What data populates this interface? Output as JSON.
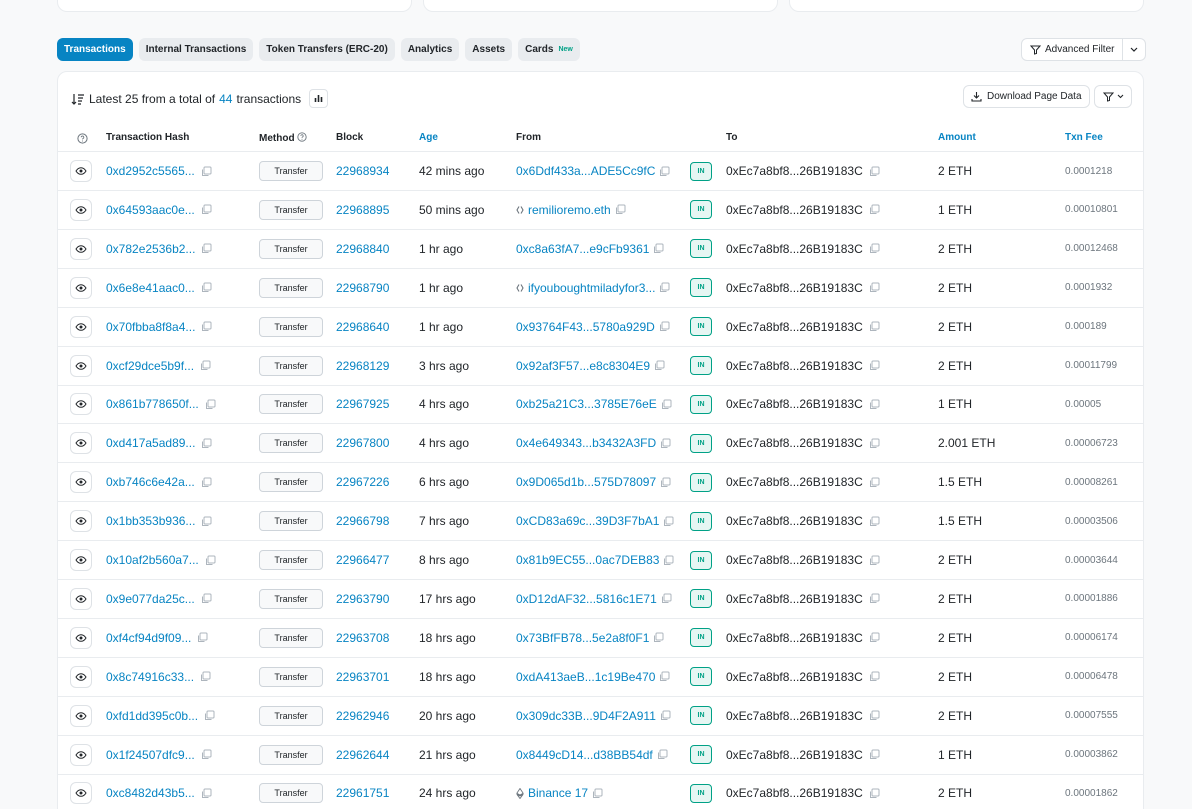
{
  "tabs": [
    {
      "label": "Transactions",
      "active": true
    },
    {
      "label": "Internal Transactions"
    },
    {
      "label": "Token Transfers (ERC-20)"
    },
    {
      "label": "Analytics"
    },
    {
      "label": "Assets"
    },
    {
      "label": "Cards",
      "badge": "New"
    }
  ],
  "advanced_filter": {
    "label": "Advanced Filter"
  },
  "summary": {
    "prefix": "Latest 25 from a total of",
    "count": "44",
    "suffix": "transactions"
  },
  "download": {
    "label": "Download Page Data"
  },
  "columns": {
    "hash": "Transaction Hash",
    "method": "Method",
    "block": "Block",
    "age": "Age",
    "from": "From",
    "to": "To",
    "amount": "Amount",
    "fee": "Txn Fee"
  },
  "rows": [
    {
      "hash": "0xd2952c5565...",
      "method": "Transfer",
      "block": "22968934",
      "age": "42 mins ago",
      "from": "0x6Ddf433a...ADE5Cc9fC",
      "from_type": "address",
      "dir": "IN",
      "to": "0xEc7a8bf8...26B19183C",
      "amount": "2 ETH",
      "fee": "0.0001218"
    },
    {
      "hash": "0x64593aac0e...",
      "method": "Transfer",
      "block": "22968895",
      "age": "50 mins ago",
      "from": "remilioremo.eth",
      "from_type": "ens",
      "dir": "IN",
      "to": "0xEc7a8bf8...26B19183C",
      "amount": "1 ETH",
      "fee": "0.00010801"
    },
    {
      "hash": "0x782e2536b2...",
      "method": "Transfer",
      "block": "22968840",
      "age": "1 hr ago",
      "from": "0xc8a63fA7...e9cFb9361",
      "from_type": "address",
      "dir": "IN",
      "to": "0xEc7a8bf8...26B19183C",
      "amount": "2 ETH",
      "fee": "0.00012468"
    },
    {
      "hash": "0x6e8e41aac0...",
      "method": "Transfer",
      "block": "22968790",
      "age": "1 hr ago",
      "from": "ifyouboughtmiladyfor3...",
      "from_type": "ens",
      "dir": "IN",
      "to": "0xEc7a8bf8...26B19183C",
      "amount": "2 ETH",
      "fee": "0.0001932"
    },
    {
      "hash": "0x70fbba8f8a4...",
      "method": "Transfer",
      "block": "22968640",
      "age": "1 hr ago",
      "from": "0x93764F43...5780a929D",
      "from_type": "address",
      "dir": "IN",
      "to": "0xEc7a8bf8...26B19183C",
      "amount": "2 ETH",
      "fee": "0.000189"
    },
    {
      "hash": "0xcf29dce5b9f...",
      "method": "Transfer",
      "block": "22968129",
      "age": "3 hrs ago",
      "from": "0x92af3F57...e8c8304E9",
      "from_type": "address",
      "dir": "IN",
      "to": "0xEc7a8bf8...26B19183C",
      "amount": "2 ETH",
      "fee": "0.00011799"
    },
    {
      "hash": "0x861b778650f...",
      "method": "Transfer",
      "block": "22967925",
      "age": "4 hrs ago",
      "from": "0xb25a21C3...3785E76eE",
      "from_type": "address",
      "dir": "IN",
      "to": "0xEc7a8bf8...26B19183C",
      "amount": "1 ETH",
      "fee": "0.00005"
    },
    {
      "hash": "0xd417a5ad89...",
      "method": "Transfer",
      "block": "22967800",
      "age": "4 hrs ago",
      "from": "0x4e649343...b3432A3FD",
      "from_type": "address",
      "dir": "IN",
      "to": "0xEc7a8bf8...26B19183C",
      "amount": "2.001 ETH",
      "fee": "0.00006723"
    },
    {
      "hash": "0xb746c6e42a...",
      "method": "Transfer",
      "block": "22967226",
      "age": "6 hrs ago",
      "from": "0x9D065d1b...575D78097",
      "from_type": "address",
      "dir": "IN",
      "to": "0xEc7a8bf8...26B19183C",
      "amount": "1.5 ETH",
      "fee": "0.00008261"
    },
    {
      "hash": "0x1bb353b936...",
      "method": "Transfer",
      "block": "22966798",
      "age": "7 hrs ago",
      "from": "0xCD83a69c...39D3F7bA1",
      "from_type": "address",
      "dir": "IN",
      "to": "0xEc7a8bf8...26B19183C",
      "amount": "1.5 ETH",
      "fee": "0.00003506"
    },
    {
      "hash": "0x10af2b560a7...",
      "method": "Transfer",
      "block": "22966477",
      "age": "8 hrs ago",
      "from": "0x81b9EC55...0ac7DEB83",
      "from_type": "address",
      "dir": "IN",
      "to": "0xEc7a8bf8...26B19183C",
      "amount": "2 ETH",
      "fee": "0.00003644"
    },
    {
      "hash": "0x9e077da25c...",
      "method": "Transfer",
      "block": "22963790",
      "age": "17 hrs ago",
      "from": "0xD12dAF32...5816c1E71",
      "from_type": "address",
      "dir": "IN",
      "to": "0xEc7a8bf8...26B19183C",
      "amount": "2 ETH",
      "fee": "0.00001886"
    },
    {
      "hash": "0xf4cf94d9f09...",
      "method": "Transfer",
      "block": "22963708",
      "age": "18 hrs ago",
      "from": "0x73BfFB78...5e2a8f0F1",
      "from_type": "address",
      "dir": "IN",
      "to": "0xEc7a8bf8...26B19183C",
      "amount": "2 ETH",
      "fee": "0.00006174"
    },
    {
      "hash": "0x8c74916c33...",
      "method": "Transfer",
      "block": "22963701",
      "age": "18 hrs ago",
      "from": "0xdA413aeB...1c19Be470",
      "from_type": "address",
      "dir": "IN",
      "to": "0xEc7a8bf8...26B19183C",
      "amount": "2 ETH",
      "fee": "0.00006478"
    },
    {
      "hash": "0xfd1dd395c0b...",
      "method": "Transfer",
      "block": "22962946",
      "age": "20 hrs ago",
      "from": "0x309dc33B...9D4F2A911",
      "from_type": "address",
      "dir": "IN",
      "to": "0xEc7a8bf8...26B19183C",
      "amount": "2 ETH",
      "fee": "0.00007555"
    },
    {
      "hash": "0x1f24507dfc9...",
      "method": "Transfer",
      "block": "22962644",
      "age": "21 hrs ago",
      "from": "0x8449cD14...d38BB54df",
      "from_type": "address",
      "dir": "IN",
      "to": "0xEc7a8bf8...26B19183C",
      "amount": "1 ETH",
      "fee": "0.00003862"
    },
    {
      "hash": "0xc8482d43b5...",
      "method": "Transfer",
      "block": "22961751",
      "age": "24 hrs ago",
      "from": "Binance 17",
      "from_type": "label",
      "dir": "IN",
      "to": "0xEc7a8bf8...26B19183C",
      "amount": "2 ETH",
      "fee": "0.00001862"
    }
  ]
}
